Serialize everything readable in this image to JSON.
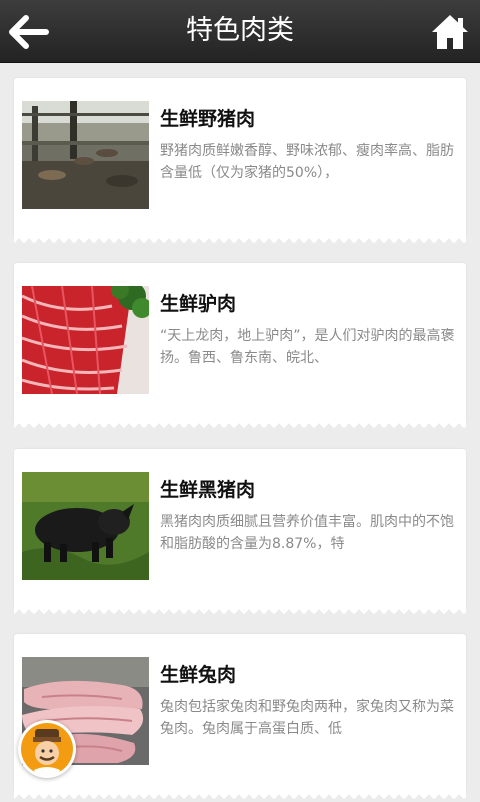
{
  "header": {
    "title": "特色肉类",
    "back_icon": "back-arrow-icon",
    "home_icon": "home-icon"
  },
  "items": [
    {
      "title": "生鲜野猪肉",
      "description": "野猪肉质鲜嫩香醇、野味浓郁、瘦肉率高、脂肪含量低（仅为家猪的50%），",
      "image": "wild-boar-pen-photo"
    },
    {
      "title": "生鲜驴肉",
      "description": "“天上龙肉，地上驴肉”，是人们对驴肉的最高褒扬。鲁西、鲁东南、皖北、",
      "image": "donkey-meat-slices-photo"
    },
    {
      "title": "生鲜黑猪肉",
      "description": "黑猪肉肉质细腻且营养价值丰富。肌肉中的不饱和脂肪酸的含量为8.87%，特",
      "image": "black-pig-on-grass-photo"
    },
    {
      "title": "生鲜兔肉",
      "description": "兔肉包括家兔肉和野兔肉两种，家兔肉又称为菜兔肉。兔肉属于高蛋白质、低",
      "image": "raw-rabbit-meat-photo"
    }
  ],
  "floating": {
    "icon": "chef-avatar-icon"
  }
}
